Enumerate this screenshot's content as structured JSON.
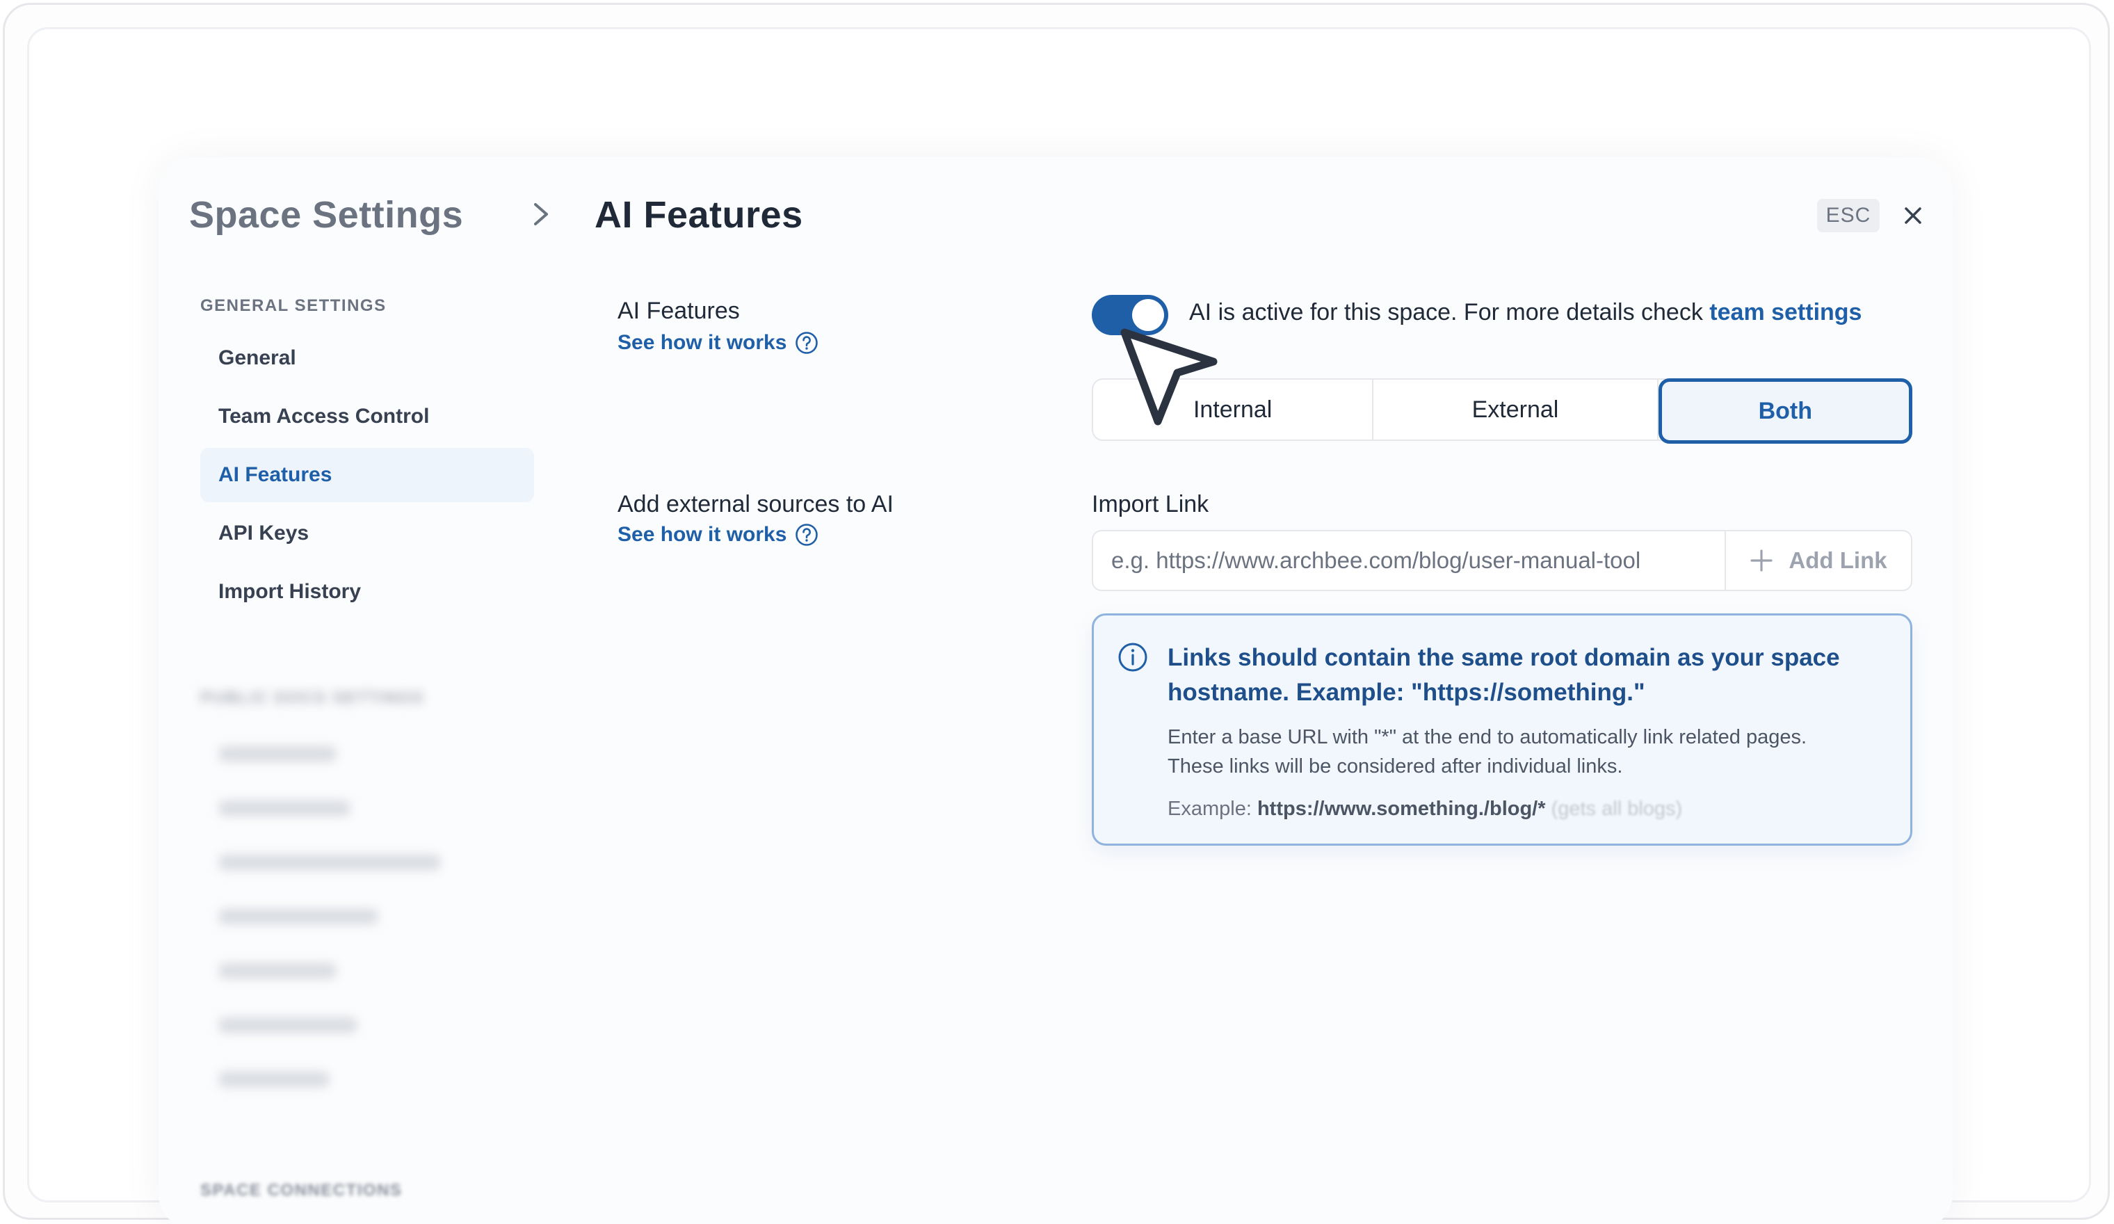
{
  "header": {
    "crumb_title": "Space Settings",
    "page_title": "AI Features",
    "esc_label": "ESC"
  },
  "sidebar": {
    "general_section_label": "GENERAL SETTINGS",
    "items": [
      {
        "label": "General"
      },
      {
        "label": "Team Access Control"
      },
      {
        "label": "AI Features",
        "active": true
      },
      {
        "label": "API Keys"
      },
      {
        "label": "Import History"
      }
    ],
    "public_section_label": "PUBLIC DOCS SETTINGS",
    "connections_section_label": "SPACE CONNECTIONS"
  },
  "ai_features": {
    "label": "AI Features",
    "how_link": "See how it works",
    "toggle_on": true,
    "status_text": "AI is active for this space. For more details check ",
    "status_link": "team settings",
    "scope_options": [
      "Internal",
      "External",
      "Both"
    ],
    "scope_selected": "Both"
  },
  "external_sources": {
    "label": "Add external sources to AI",
    "how_link": "See how it works",
    "field_label": "Import Link",
    "placeholder": "e.g. https://www.archbee.com/blog/user-manual-tool",
    "add_button": "Add Link"
  },
  "info": {
    "title": "Links should contain the same root domain as your space hostname. Example: \"https://something.\"",
    "body_line1": "Enter a base URL with \"*\" at the end to automatically link related pages.",
    "body_line2": "These links will be considered after individual links.",
    "example_prefix": "Example: ",
    "example_url": "https://www.something./blog/*",
    "example_suffix": " (gets all blogs)"
  },
  "colors": {
    "accent": "#1e5fa8",
    "info_border": "#8fb3dc",
    "info_bg": "#f2f7fd"
  }
}
